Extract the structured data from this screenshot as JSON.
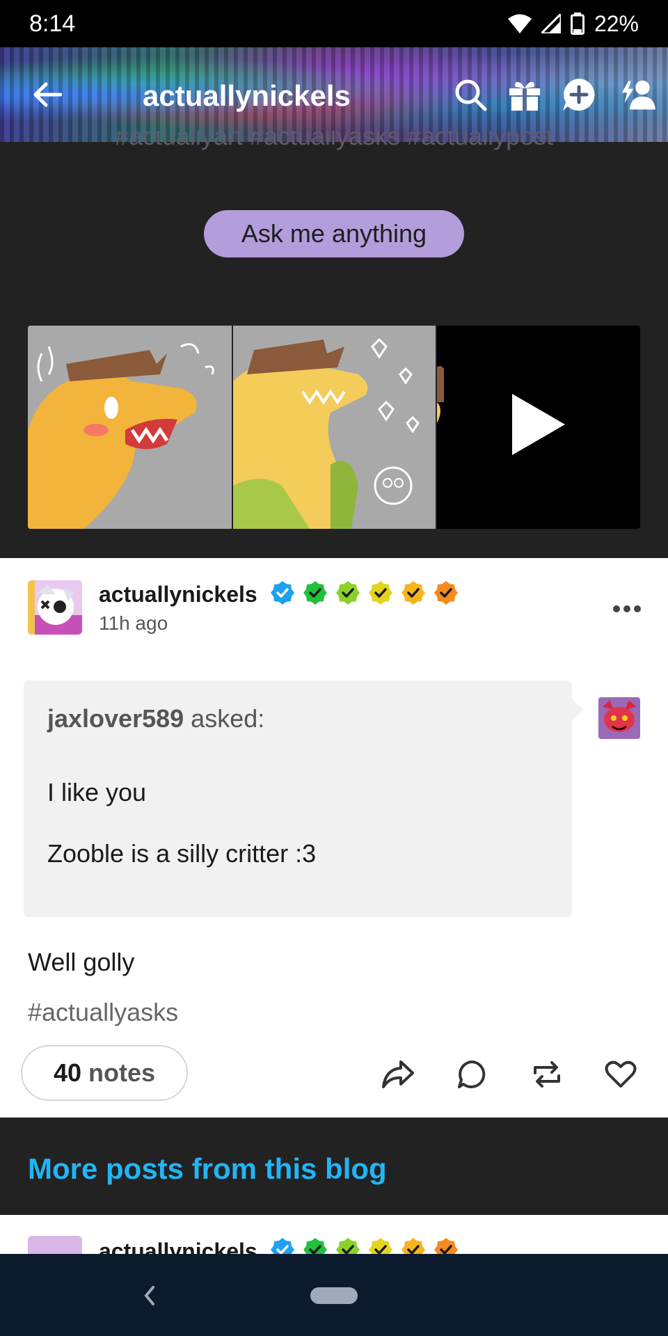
{
  "status_bar": {
    "time": "8:14",
    "battery": "22%"
  },
  "header": {
    "title": "actuallynickels"
  },
  "faded_tags": "#actuallyart #actuallyasks #actuallypost",
  "ask_button": "Ask me anything",
  "post": {
    "username": "actuallynickels",
    "time": "11h ago",
    "badge_colors": [
      "#1da1f2",
      "#1fc23a",
      "#8bd12a",
      "#e3d323",
      "#f5b51e",
      "#f58a1e"
    ],
    "ask": {
      "asker": "jaxlover589",
      "asked_label": "asked:",
      "line1": "I like you",
      "line2": "Zooble is a silly critter :3"
    },
    "reply": "Well golly",
    "tag": "#actuallyasks",
    "notes_count": "40",
    "notes_label": "notes"
  },
  "more_posts": {
    "title": "More posts from this blog"
  },
  "next_post": {
    "username": "actuallynickels"
  }
}
